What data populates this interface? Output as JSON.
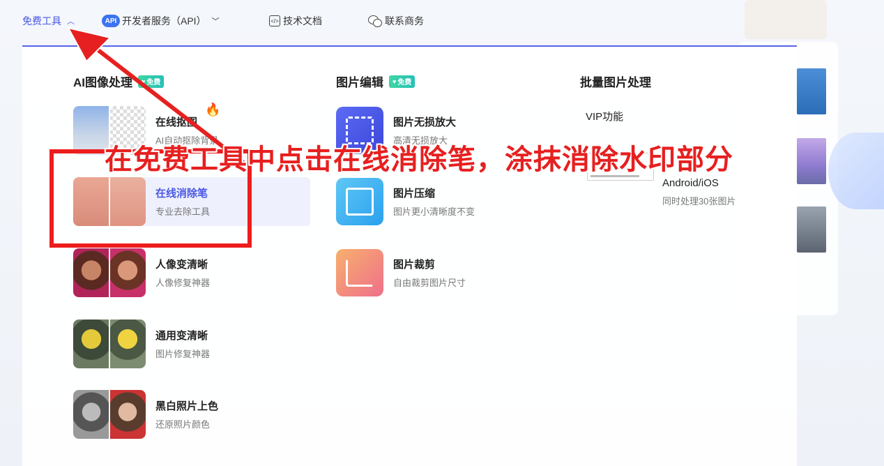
{
  "nav": {
    "free_tools": "免费工具",
    "api_badge": "API",
    "developer": "开发者服务（API）",
    "docs": "技术文档",
    "contact": "联系商务"
  },
  "columns": {
    "ai": {
      "title": "AI图像处理",
      "badge": "免费"
    },
    "edit": {
      "title": "图片编辑",
      "badge": "免费"
    },
    "batch": {
      "title": "批量图片处理"
    }
  },
  "ai_tools": [
    {
      "name": "在线抠图",
      "desc": "AI自动抠除背景"
    },
    {
      "name": "在线消除笔",
      "desc": "专业去除工具"
    },
    {
      "name": "人像变清晰",
      "desc": "人像修复神器"
    },
    {
      "name": "通用变清晰",
      "desc": "图片修复神器"
    },
    {
      "name": "黑白照片上色",
      "desc": "还原照片颜色"
    }
  ],
  "edit_tools": [
    {
      "name": "图片无损放大",
      "desc": "高清无损放大"
    },
    {
      "name": "图片压缩",
      "desc": "图片更小清晰度不变"
    },
    {
      "name": "图片裁剪",
      "desc": "自由裁剪图片尺寸"
    }
  ],
  "batch": {
    "vip": "VIP功能",
    "platform": "Android/iOS",
    "desc": "同时处理30张图片"
  },
  "annotation": {
    "caption": "在免费工具中点击在线消除笔，涂抹消除水印部分",
    "color": "#e62020"
  }
}
